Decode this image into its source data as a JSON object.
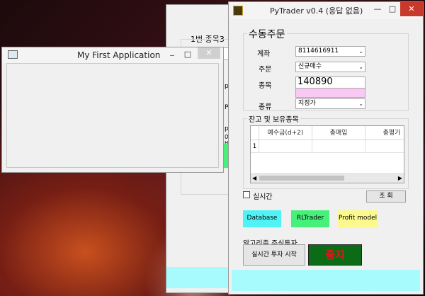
{
  "windows": {
    "back": {
      "title_partial": "1번 종목3",
      "labels": [
        "p",
        "P",
        "p",
        "여",
        "바"
      ]
    },
    "first": {
      "title": "My First Application",
      "minimize": "_",
      "maximize": "□",
      "close": "✕"
    },
    "main": {
      "title": "PyTrader v0.4 (응답 없음)",
      "minimize": "—",
      "maximize": "□",
      "close": "✕",
      "manual_order": {
        "title": "수동주문",
        "account_label": "계좌",
        "account_value": "8114616911",
        "order_label": "주문",
        "order_value": "신규매수",
        "stock_label": "종목",
        "stock_value": "140890",
        "type_label": "종류",
        "type_value": "지정가"
      },
      "holdings": {
        "title": "잔고 및 보유종목",
        "columns": [
          "예수금(d+2)",
          "총매입",
          "총평가"
        ],
        "row_number": "1"
      },
      "realtime_label": "실시간",
      "inquiry_button": "조 회",
      "buttons": {
        "database": "Database",
        "rltrader": "RLTrader",
        "profit": "Profit model"
      },
      "algo": {
        "title": "알고리즘 주식투자",
        "start": "실시간 투자 시작",
        "stop": "중지"
      }
    }
  },
  "colors": {
    "database": "#4ff3f5",
    "rltrader": "#47f07a",
    "profit": "#fbf98e",
    "stop_bg": "#0b6b16",
    "stop_text": "#e01818",
    "stock_pink": "#f9c8f3",
    "status_cyan": "#a8fbfd"
  }
}
